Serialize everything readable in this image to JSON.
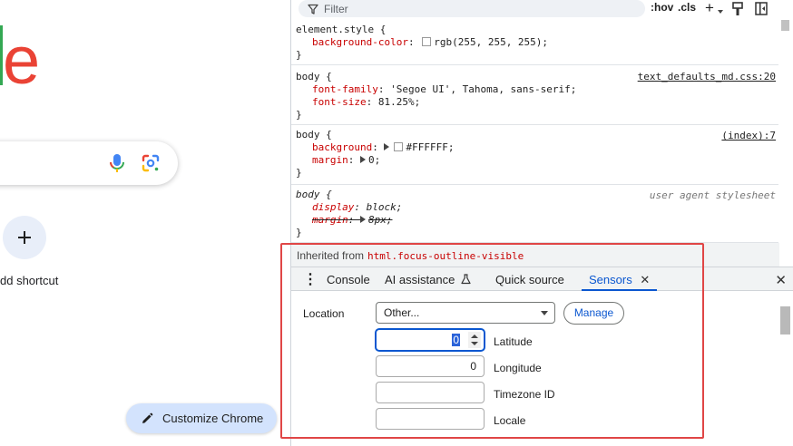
{
  "page": {
    "logo_letter": "e",
    "add_shortcut_label": "dd shortcut",
    "customize_label": "Customize Chrome"
  },
  "devtools": {
    "filter_placeholder": "Filter",
    "toolbar": {
      "hov": ":hov",
      "cls": ".cls"
    },
    "rules": [
      {
        "selector": "element.style {",
        "source": "",
        "props": [
          {
            "name": "background-color",
            "value": "rgb(255, 255, 255);"
          }
        ],
        "close": "}"
      },
      {
        "selector": "body {",
        "source": "text_defaults_md.css:20",
        "props": [
          {
            "name": "font-family",
            "value": "'Segoe UI', Tahoma, sans-serif;"
          },
          {
            "name": "font-size",
            "value": "81.25%;"
          }
        ],
        "close": "}"
      },
      {
        "selector": "body {",
        "source": "(index):7",
        "props": [
          {
            "name": "background",
            "value": "#FFFFFF;"
          },
          {
            "name": "margin",
            "value": "0;"
          }
        ],
        "close": "}"
      },
      {
        "selector": "body {",
        "source": "user agent stylesheet",
        "props": [
          {
            "name": "display",
            "value": "block;"
          },
          {
            "name": "margin",
            "value": "8px;"
          }
        ],
        "close": "}"
      }
    ],
    "inherited_label": "Inherited from",
    "inherited_selector": "html.focus-outline-visible",
    "drawer_tabs": [
      "Console",
      "AI assistance",
      "Quick source",
      "Sensors"
    ],
    "sensors": {
      "location_label": "Location",
      "location_value": "Other...",
      "manage_label": "Manage",
      "latitude_value": "0",
      "latitude_label": "Latitude",
      "longitude_value": "0",
      "longitude_label": "Longitude",
      "timezone_value": "",
      "timezone_label": "Timezone ID",
      "locale_value": "",
      "locale_label": "Locale"
    }
  },
  "colors": {
    "logo_red": "#ea4335",
    "accent_blue": "#0b57d0",
    "css_property": "#c80000",
    "highlight_red": "#e04646",
    "customize_bg": "#d3e3fd"
  }
}
